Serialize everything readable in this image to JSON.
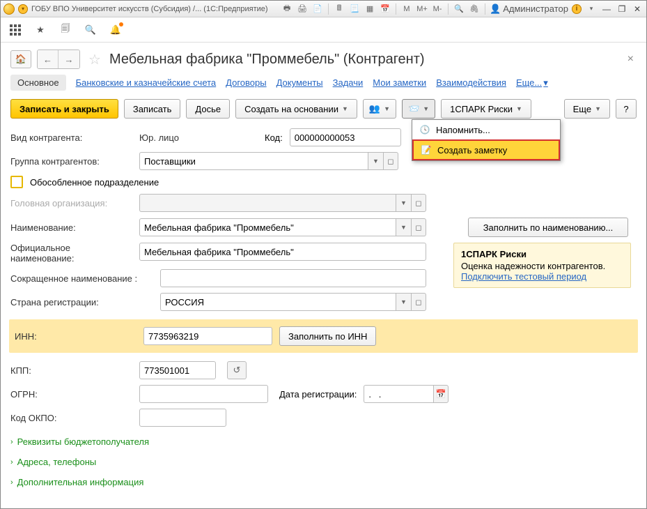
{
  "window": {
    "title": "ГОБУ ВПО Университет искусств (Субсидия) /... (1С:Предприятие)",
    "user": "Администратор"
  },
  "header": {
    "title": "Мебельная фабрика \"Проммебель\" (Контрагент)"
  },
  "tabs": {
    "active": "Основное",
    "t1": "Банковские и казначейские счета",
    "t2": "Договоры",
    "t3": "Документы",
    "t4": "Задачи",
    "t5": "Мои заметки",
    "t6": "Взаимодействия",
    "more": "Еще..."
  },
  "toolbar": {
    "save_close": "Записать и закрыть",
    "save": "Записать",
    "dossier": "Досье",
    "create_based": "Создать на основании",
    "spark": "1СПАРК Риски",
    "more": "Еще",
    "help": "?"
  },
  "menu": {
    "remind": "Напомнить...",
    "note": "Создать заметку"
  },
  "form": {
    "type_lbl": "Вид контрагента:",
    "type_val": "Юр. лицо",
    "code_lbl": "Код:",
    "code_val": "000000000053",
    "group_lbl": "Группа контрагентов:",
    "group_val": "Поставщики",
    "separate_lbl": "Обособленное подразделение",
    "head_lbl": "Головная организация:",
    "name_lbl": "Наименование:",
    "name_val": "Мебельная фабрика \"Проммебель\"",
    "fill_by_name": "Заполнить по наименованию...",
    "official_lbl": "Официальное наименование:",
    "official_val": "Мебельная фабрика \"Проммебель\"",
    "short_lbl": "Сокращенное наименование :",
    "country_lbl": "Страна регистрации:",
    "country_val": "РОССИЯ",
    "inn_lbl": "ИНН:",
    "inn_val": "7735963219",
    "fill_by_inn": "Заполнить по ИНН",
    "kpp_lbl": "КПП:",
    "kpp_val": "773501001",
    "ogrn_lbl": "ОГРН:",
    "regdate_lbl": "Дата регистрации:",
    "regdate_val": ".   .",
    "okpo_lbl": "Код ОКПО:"
  },
  "sidebox": {
    "title": "1СПАРК Риски",
    "desc": "Оценка надежности контрагентов.",
    "link": "Подключить тестовый период"
  },
  "expanders": {
    "e1": "Реквизиты бюджетополучателя",
    "e2": "Адреса, телефоны",
    "e3": "Дополнительная информация"
  }
}
